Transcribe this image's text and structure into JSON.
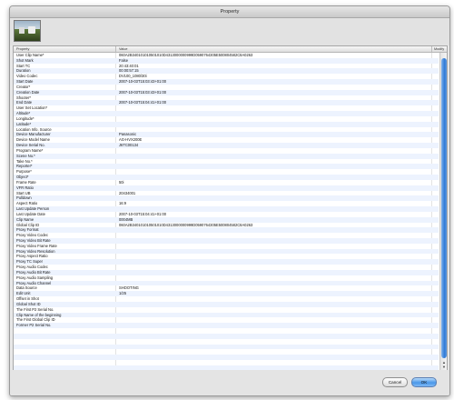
{
  "window": {
    "title": "Property"
  },
  "table": {
    "columns": [
      "Property",
      "Value",
      "Modify"
    ],
    "rows": [
      {
        "property": "User Clip Name*",
        "value": "060A2B340101010501010D4313000000999D0590764305E500804582C8A0263"
      },
      {
        "property": "Shot Mark",
        "value": "False"
      },
      {
        "property": "Start TC",
        "value": "20:43:40:01"
      },
      {
        "property": "Duration",
        "value": "00:00:57:15"
      },
      {
        "property": "Video Codec",
        "value": "DV100_1080/30i"
      },
      {
        "property": "Start Date",
        "value": "2007-10-03T15:03:43+01:00"
      },
      {
        "property": "Creator*",
        "value": ""
      },
      {
        "property": "Creation Date",
        "value": "2007-10-03T15:03:43+01:00"
      },
      {
        "property": "Shooter*",
        "value": ""
      },
      {
        "property": "End Date",
        "value": "2007-10-03T15:04:41+01:00"
      },
      {
        "property": "User Set Location*",
        "value": ""
      },
      {
        "property": "Altitude*",
        "value": ""
      },
      {
        "property": "Longitude*",
        "value": ""
      },
      {
        "property": "Latitude*",
        "value": ""
      },
      {
        "property": "Location Info. Source",
        "value": ""
      },
      {
        "property": "Device Manufacturer",
        "value": "Panasonic"
      },
      {
        "property": "Device Model Name",
        "value": "AG-HVX200E"
      },
      {
        "property": "Device Serial No.",
        "value": "J6TC00134"
      },
      {
        "property": "Program Name*",
        "value": ""
      },
      {
        "property": "Scene No.*",
        "value": ""
      },
      {
        "property": "Take No.*",
        "value": ""
      },
      {
        "property": "Reporter*",
        "value": ""
      },
      {
        "property": "Purpose*",
        "value": ""
      },
      {
        "property": "Object*",
        "value": ""
      },
      {
        "property": "Frame Rate",
        "value": "50i"
      },
      {
        "property": "VFR Ratio",
        "value": ""
      },
      {
        "property": "Start UB",
        "value": "20434001"
      },
      {
        "property": "Pulldown",
        "value": ""
      },
      {
        "property": "Aspect Ratio",
        "value": "16:9"
      },
      {
        "property": "Last Update Person",
        "value": ""
      },
      {
        "property": "Last Update Date",
        "value": "2007-10-03T15:04:41+01:00"
      },
      {
        "property": "Clip Name",
        "value": "0004MB"
      },
      {
        "property": "Global Clip ID",
        "value": "060A2B340101010501010D4313000000999D0590764305E500804582C8A0263"
      },
      {
        "property": "Proxy Format",
        "value": ""
      },
      {
        "property": "Proxy Video Codec",
        "value": ""
      },
      {
        "property": "Proxy Video Bit Rate",
        "value": ""
      },
      {
        "property": "Proxy Video Frame Rate",
        "value": ""
      },
      {
        "property": "Proxy Video Resolution",
        "value": ""
      },
      {
        "property": "Proxy Aspect Ratio",
        "value": ""
      },
      {
        "property": "Proxy TC Super",
        "value": ""
      },
      {
        "property": "Proxy Audio Codec",
        "value": ""
      },
      {
        "property": "Proxy Audio Bit Rate",
        "value": ""
      },
      {
        "property": "Proxy Audio Sampling",
        "value": ""
      },
      {
        "property": "Proxy Audio Channel",
        "value": ""
      },
      {
        "property": "Data Source",
        "value": "SHOOTING"
      },
      {
        "property": "Edit Unit",
        "value": "1/25"
      },
      {
        "property": "Offset in Shot",
        "value": ""
      },
      {
        "property": "Global Shot ID",
        "value": ""
      },
      {
        "property": "The First P2 Serial No.",
        "value": ""
      },
      {
        "property": "Clip Name of the beginning",
        "value": ""
      },
      {
        "property": "The First Global Clip ID",
        "value": ""
      },
      {
        "property": "Former P2 Serial No.",
        "value": ""
      },
      {
        "property": "",
        "value": ""
      },
      {
        "property": "",
        "value": ""
      },
      {
        "property": "",
        "value": ""
      },
      {
        "property": "",
        "value": ""
      },
      {
        "property": "",
        "value": ""
      },
      {
        "property": "",
        "value": ""
      },
      {
        "property": "",
        "value": ""
      },
      {
        "property": "",
        "value": ""
      }
    ]
  },
  "buttons": {
    "cancel": "Cancel",
    "ok": "OK"
  },
  "colors": {
    "ok_button": "#4a97e9",
    "stripe": "#edf3fe",
    "scroll_thumb": "#2f7ad6"
  },
  "icons": {
    "thumbnail": "clip-thumbnail-image"
  }
}
